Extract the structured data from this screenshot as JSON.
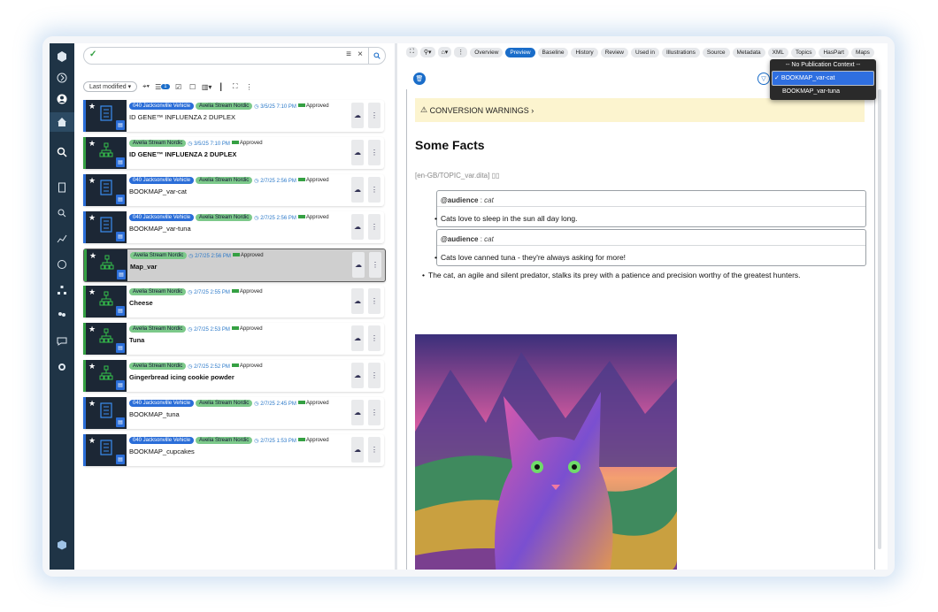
{
  "colors": {
    "accent": "#1a6dc9",
    "approved": "#35a043",
    "rail": "#1f3446"
  },
  "search": {
    "value": "",
    "clear": "×",
    "menu": "≡",
    "go": "🔍"
  },
  "sort": {
    "label": "Last modified",
    "count": "1"
  },
  "list": [
    {
      "tags": [
        "040 Jacksonville Vehicle",
        "Avelia Stream Nordic"
      ],
      "date": "3/5/25 7:10 PM",
      "status": "Approved",
      "title": "ID GENE™ INFLUENZA 2 DUPLEX",
      "icon": "book-icon",
      "bold": false
    },
    {
      "tags": [
        "Avelia Stream Nordic"
      ],
      "date": "3/5/25 7:10 PM",
      "status": "Approved",
      "title": "ID GENE™ INFLUENZA 2 DUPLEX",
      "icon": "map-icon",
      "bold": true
    },
    {
      "tags": [
        "040 Jacksonville Vehicle",
        "Avelia Stream Nordic"
      ],
      "date": "2/7/25 2:56 PM",
      "status": "Approved",
      "title": "BOOKMAP_var-cat",
      "icon": "book-icon",
      "bold": false
    },
    {
      "tags": [
        "040 Jacksonville Vehicle",
        "Avelia Stream Nordic"
      ],
      "date": "2/7/25 2:56 PM",
      "status": "Approved",
      "title": "BOOKMAP_var-tuna",
      "icon": "book-icon",
      "bold": false
    },
    {
      "tags": [
        "Avelia Stream Nordic"
      ],
      "date": "2/7/25 2:56 PM",
      "status": "Approved",
      "title": "Map_var",
      "icon": "map-icon",
      "bold": true
    },
    {
      "tags": [
        "Avelia Stream Nordic"
      ],
      "date": "2/7/25 2:55 PM",
      "status": "Approved",
      "title": "Cheese",
      "icon": "map-icon",
      "bold": true
    },
    {
      "tags": [
        "Avelia Stream Nordic"
      ],
      "date": "2/7/25 2:53 PM",
      "status": "Approved",
      "title": "Tuna",
      "icon": "map-icon",
      "bold": true
    },
    {
      "tags": [
        "Avelia Stream Nordic"
      ],
      "date": "2/7/25 2:52 PM",
      "status": "Approved",
      "title": "Gingerbread icing cookie powder",
      "icon": "map-icon",
      "bold": true
    },
    {
      "tags": [
        "040 Jacksonville Vehicle",
        "Avelia Stream Nordic"
      ],
      "date": "2/7/25 2:45 PM",
      "status": "Approved",
      "title": "BOOKMAP_tuna",
      "icon": "book-icon",
      "bold": false
    },
    {
      "tags": [
        "040 Jacksonville Vehicle",
        "Avelia Stream Nordic"
      ],
      "date": "2/7/25 1:53 PM",
      "status": "Approved",
      "title": "BOOKMAP_cupcakes",
      "icon": "book-icon",
      "bold": false
    }
  ],
  "tabs": [
    "Overview",
    "Preview",
    "Baseline",
    "History",
    "Review",
    "Used in",
    "Illustrations",
    "Source",
    "Metadata",
    "XML",
    "Topics",
    "HasPart",
    "Maps"
  ],
  "dropdown": {
    "header": "-- No Publication Context --",
    "options": [
      "BOOKMAP_var-cat",
      "BOOKMAP_var-tuna"
    ],
    "selected": "BOOKMAP_var-cat"
  },
  "preview": {
    "warning": "CONVERSION WARNINGS",
    "heading": "Some Facts",
    "path": "[en-GB/TOPIC_var.dita]",
    "blocks": [
      {
        "attr": "@audience",
        "value": "cat",
        "text": "Cats love to sleep in the sun all day long."
      },
      {
        "attr": "@audience",
        "value": "cat",
        "text": "Cats love canned tuna - they're always asking for more!"
      }
    ],
    "bullet": "The cat, an agile and silent predator, stalks its prey with a patience and precision worthy of the greatest hunters."
  }
}
